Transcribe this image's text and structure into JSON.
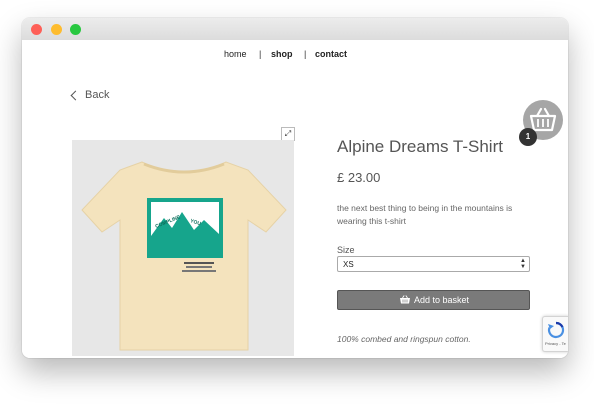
{
  "nav": {
    "items": [
      "home",
      "shop",
      "contact"
    ],
    "separator": "|"
  },
  "back_label": "Back",
  "product": {
    "title": "Alpine Dreams T-Shirt",
    "price": "£ 23.00",
    "description": "the next best thing to being in the mountains is wearing this t-shirt",
    "size_label": "Size",
    "size_value": "XS",
    "add_to_basket_label": "Add to basket",
    "material": "100% combed and ringspun cotton."
  },
  "cart": {
    "count": "1",
    "icon": "basket-icon"
  },
  "recaptcha": {
    "text": "Privacy - Te"
  },
  "colors": {
    "tshirt": "#f4e3bd",
    "print_green": "#16a58c",
    "button": "#7a7a7a",
    "cart_circle": "#a6a6a6"
  }
}
